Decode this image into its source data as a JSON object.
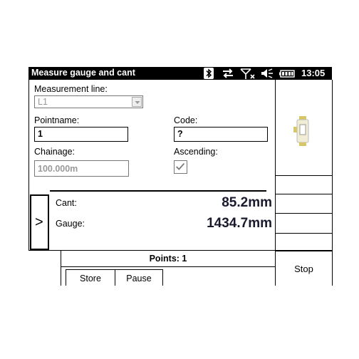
{
  "window": {
    "title": "Measure gauge and cant",
    "clock": "13:05"
  },
  "status_icons": [
    "bluetooth-icon",
    "sync-arrows-icon",
    "signal-off-icon",
    "speaker-icon",
    "battery-icon"
  ],
  "form": {
    "measurement_line_label": "Measurement line:",
    "measurement_line_value": "L1",
    "pointname_label": "Pointname:",
    "pointname_value": "1",
    "code_label": "Code:",
    "code_value": "?",
    "chainage_label": "Chainage:",
    "chainage_value": "100.000m",
    "ascending_label": "Ascending:",
    "ascending_checked": true
  },
  "readings": {
    "cant_label": "Cant:",
    "cant_value": "85.2mm",
    "gauge_label": "Gauge:",
    "gauge_value": "1434.7mm",
    "pointer": ">"
  },
  "bottom": {
    "points_text": "Points: 1",
    "store_label": "Store",
    "pause_label": "Pause",
    "stop_label": "Stop"
  }
}
